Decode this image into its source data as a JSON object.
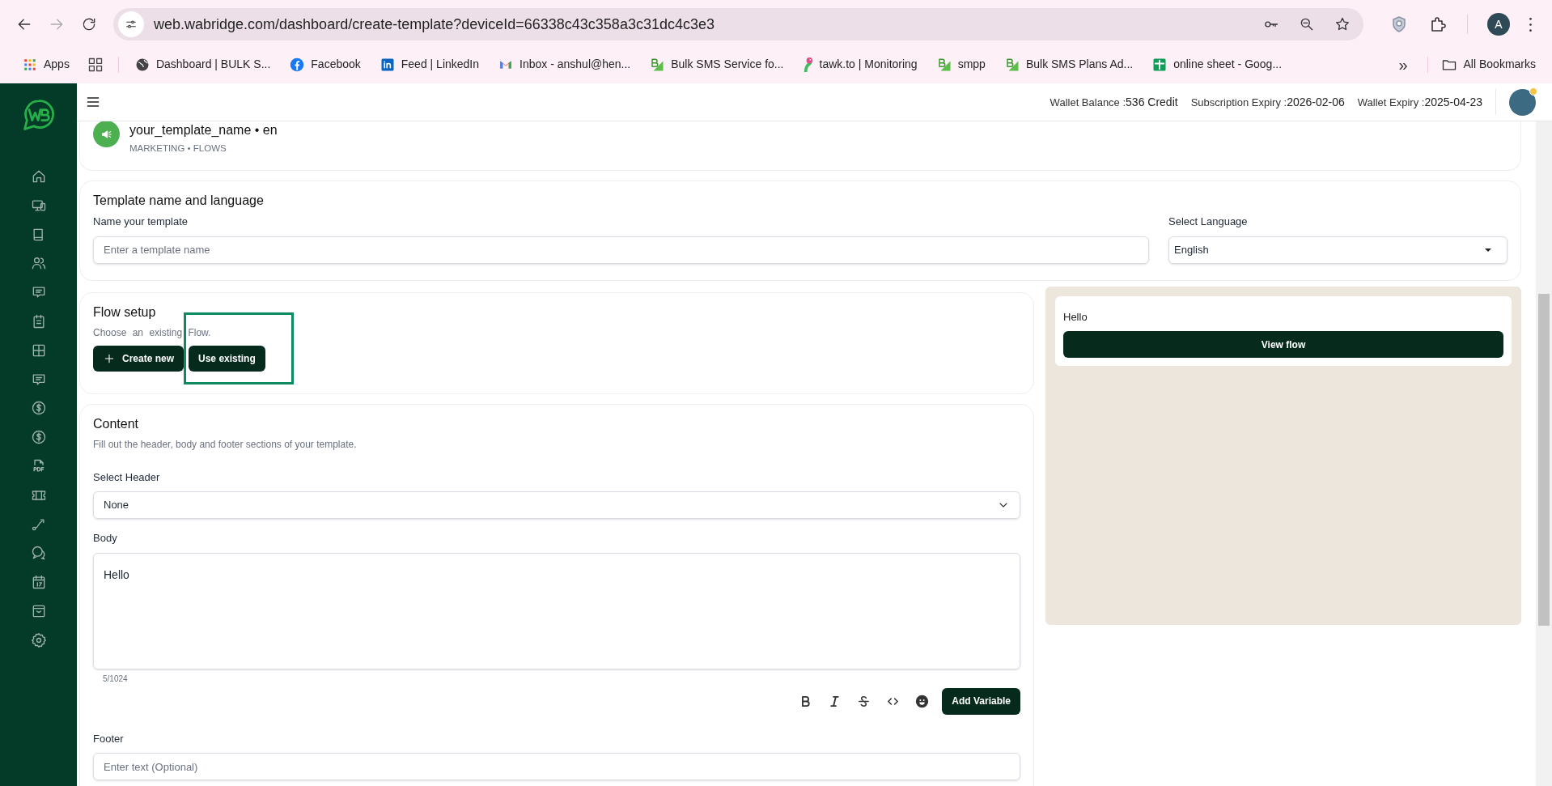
{
  "browser": {
    "url": "web.wabridge.com/dashboard/create-template?deviceId=66338c43c358a3c31dc4c3e3",
    "profile": "A",
    "bookmarks": [
      {
        "kind": "apps",
        "label": "Apps"
      },
      {
        "kind": "groups"
      },
      {
        "kind": "globe",
        "label": "Dashboard | BULK S..."
      },
      {
        "kind": "facebook",
        "label": "Facebook"
      },
      {
        "kind": "linkedin",
        "label": "Feed | LinkedIn"
      },
      {
        "kind": "gmail",
        "label": "Inbox - anshul@hen..."
      },
      {
        "kind": "wab",
        "label": "Bulk SMS Service fo..."
      },
      {
        "kind": "tawk",
        "label": "tawk.to | Monitoring"
      },
      {
        "kind": "wab",
        "label": "smpp"
      },
      {
        "kind": "wab",
        "label": "Bulk SMS Plans Ad..."
      },
      {
        "kind": "sheets",
        "label": "online sheet - Goog..."
      }
    ],
    "more": "»",
    "all_bookmarks": "All Bookmarks"
  },
  "sidebar": {
    "items": [
      {
        "kind": "home"
      },
      {
        "kind": "devices"
      },
      {
        "kind": "book"
      },
      {
        "kind": "users"
      },
      {
        "kind": "message"
      },
      {
        "kind": "clipboard"
      },
      {
        "kind": "grid"
      },
      {
        "kind": "message"
      },
      {
        "kind": "dollar"
      },
      {
        "kind": "dollar"
      },
      {
        "kind": "pdf"
      },
      {
        "kind": "ticket"
      },
      {
        "kind": "route"
      },
      {
        "kind": "chat"
      },
      {
        "kind": "calendar"
      },
      {
        "kind": "archive"
      },
      {
        "kind": "settings"
      }
    ]
  },
  "header": {
    "stats": [
      {
        "label": "Wallet Balance :",
        "value": "536 Credit"
      },
      {
        "label": "Subscription Expiry :",
        "value": "2026-02-06"
      },
      {
        "label": "Wallet Expiry :",
        "value": "2025-04-23"
      }
    ]
  },
  "template": {
    "title": "your_template_name • en",
    "subtitle": "MARKETING • FLOWS"
  },
  "name_section": {
    "title": "Template name and language",
    "name_label": "Name your template",
    "name_placeholder": "Enter a template name",
    "language_label": "Select Language",
    "language_value": "English"
  },
  "flow_setup": {
    "title": "Flow setup",
    "description": "Choose an existing Flow.",
    "buttons": [
      {
        "kind": "create",
        "label": "Create new"
      },
      {
        "kind": "existing",
        "label": "Use existing",
        "highlighted": true
      }
    ]
  },
  "preview": {
    "message": "Hello",
    "button": "View flow"
  },
  "content": {
    "title": "Content",
    "description": "Fill out the header, body and footer sections of your template.",
    "header_label": "Select Header",
    "header_value": "None",
    "body_label": "Body",
    "body_value": "Hello",
    "counter": "5/1024",
    "format_tools": [
      {
        "kind": "bold"
      },
      {
        "kind": "italic"
      },
      {
        "kind": "strike"
      },
      {
        "kind": "code"
      },
      {
        "kind": "emoji"
      }
    ],
    "add_variable": "Add Variable",
    "footer_label": "Footer",
    "footer_placeholder": "Enter text (Optional)"
  }
}
